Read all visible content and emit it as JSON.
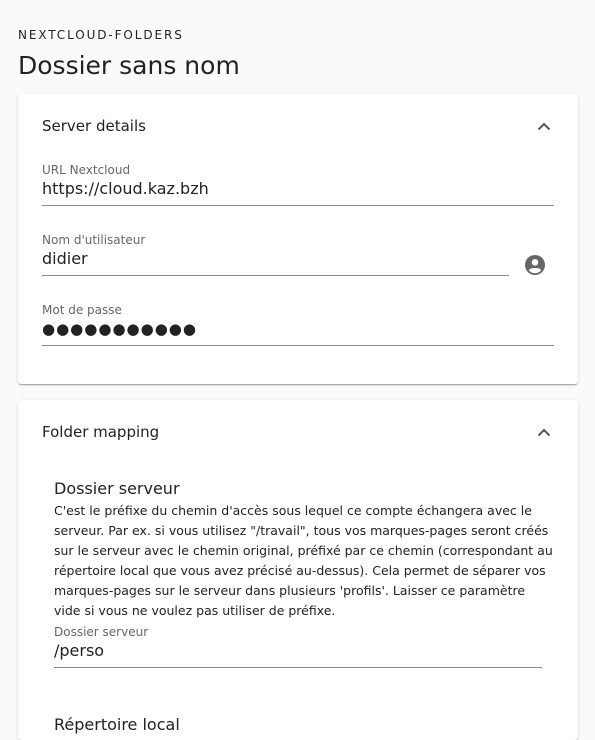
{
  "header": {
    "overline": "NEXTCLOUD-FOLDERS",
    "title": "Dossier sans nom"
  },
  "server_details": {
    "title": "Server details",
    "url_label": "URL Nextcloud",
    "url_value": "https://cloud.kaz.bzh",
    "username_label": "Nom d'utilisateur",
    "username_value": "didier",
    "password_label": "Mot de passe",
    "password_value": "●●●●●●●●●●●"
  },
  "folder_mapping": {
    "title": "Folder mapping",
    "server_folder_heading": "Dossier serveur",
    "server_folder_description": "C'est le préfixe du chemin d'accès sous lequel ce compte échangera avec le serveur. Par ex. si vous utilisez \"/travail\", tous vos marques-pages seront créés sur le serveur avec le chemin original, préfixé par ce chemin (correspondant au répertoire local que vous avez précisé au-dessus). Cela permet de séparer vos marques-pages sur le serveur dans plusieurs 'profils'. Laisser ce paramètre vide si vous ne voulez pas utiliser de préfixe.",
    "server_folder_label": "Dossier serveur",
    "server_folder_value": "/perso",
    "local_folder_heading": "Répertoire local"
  },
  "icons": {
    "collapse": "chevron-up-icon",
    "account": "account-circle-icon"
  }
}
